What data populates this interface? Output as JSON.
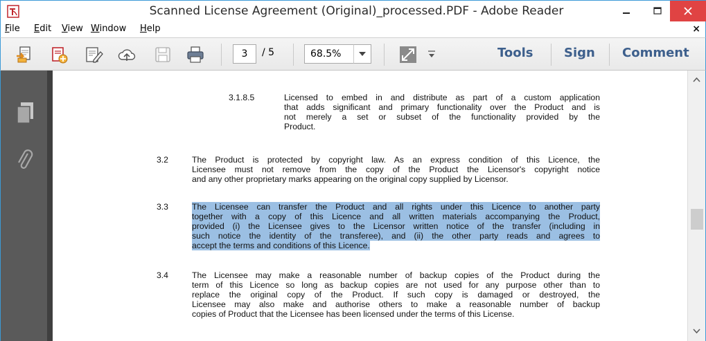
{
  "window": {
    "title": "Scanned License Agreement (Original)_processed.PDF - Adobe Reader",
    "minimize_glyph": "–",
    "maximize_glyph": "☐",
    "close_glyph": "✕"
  },
  "menu": {
    "items": [
      "File",
      "Edit",
      "View",
      "Window",
      "Help"
    ],
    "underline_first": [
      "F",
      "E",
      "V",
      "W",
      "H"
    ],
    "rest": [
      "ile",
      "dit",
      "iew",
      "indow",
      "elp"
    ],
    "close_glyph": "×"
  },
  "toolbar": {
    "icons": [
      "open-icon",
      "create-pdf-icon",
      "edit-sign-icon",
      "upload-cloud-icon",
      "save-icon",
      "print-icon"
    ],
    "page_current": "3",
    "page_total": "/ 5",
    "zoom": "68.5%",
    "tools_label": "Tools",
    "sign_label": "Sign",
    "comment_label": "Comment"
  },
  "left_rail": {
    "icons": [
      "pages-panel-icon",
      "attachments-paperclip-icon"
    ]
  },
  "document": {
    "section_3_1_8_5": {
      "num": "3.1.8.5",
      "lines": [
        "Licensed to embed in and distribute as part of a custom application",
        "that adds significant and primary functionality over the Product and is",
        "not merely a set or subset of the functionality provided by the",
        "Product."
      ]
    },
    "section_3_2": {
      "num": "3.2",
      "lines": [
        "The Product is protected by copyright law. As an express condition of this Licence, the",
        "Licensee must not remove from the copy of the Product the Licensor's copyright notice",
        "and any other proprietary marks appearing on the original copy supplied by Licensor."
      ]
    },
    "section_3_3": {
      "num": "3.3",
      "lines": [
        "The Licensee can transfer the Product and all rights under this Licence to another party",
        "together with a copy of this Licence and all written materials accompanying the Product,",
        "provided (i) the Licensee gives to the Licensor written notice of the transfer (including in",
        "such notice the identity of the transferee), and (ii) the other party reads and agrees to",
        "accept the terms and conditions of this Licence."
      ]
    },
    "section_3_4": {
      "num": "3.4",
      "lines": [
        "The Licensee may make a reasonable number of backup copies of the Product during the",
        "term of this Licence so long as backup copies are not used for any purpose other than to",
        "replace the original copy of the Product. If such copy is damaged or destroyed, the",
        "Licensee may also make and authorise others to make a reasonable number of backup",
        "copies of Product that the Licensee has been licensed under the terms of this License."
      ]
    }
  },
  "colors": {
    "highlight": "#9bbfe3",
    "close_button": "#e04343",
    "window_border": "#3c9ad7",
    "toolbar_text": "#3d5f8c"
  }
}
